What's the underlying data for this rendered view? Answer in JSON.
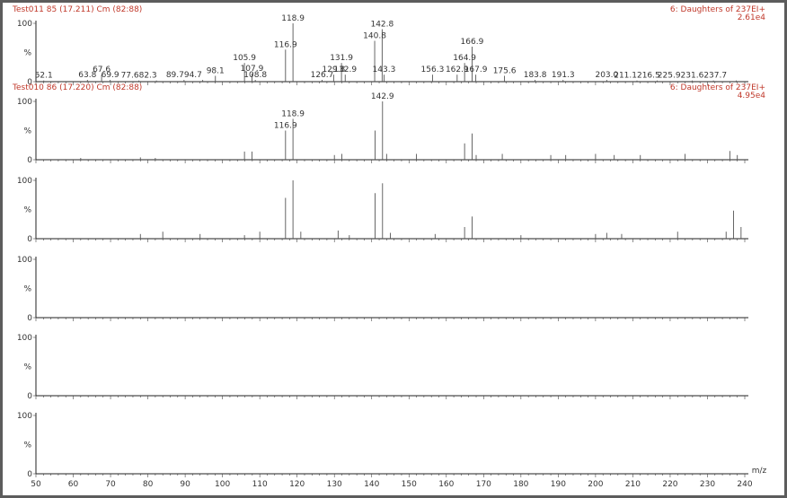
{
  "chart_data": [
    {
      "type": "bar",
      "header_left": "Test011 85 (17.211) Cm (82:88)",
      "header_right": "6: Daughters of 237EI+",
      "intensity": "2.61e4",
      "y_ticks": [
        "100",
        "%",
        "0"
      ],
      "ylim": [
        0,
        100
      ],
      "xlim": [
        50,
        240
      ],
      "peaks": [
        {
          "mz": 52.1,
          "rel": 2,
          "label": "52.1"
        },
        {
          "mz": 63.8,
          "rel": 3,
          "label": "63.8"
        },
        {
          "mz": 67.6,
          "rel": 12,
          "label": "67.6"
        },
        {
          "mz": 69.9,
          "rel": 3,
          "label": "69.9"
        },
        {
          "mz": 77.6,
          "rel": 2,
          "label": "77.6"
        },
        {
          "mz": 82.3,
          "rel": 2,
          "label": "82.3"
        },
        {
          "mz": 89.7,
          "rel": 3,
          "label": "89.7"
        },
        {
          "mz": 94.7,
          "rel": 3,
          "label": "94.7"
        },
        {
          "mz": 98.1,
          "rel": 10,
          "label": "98.1"
        },
        {
          "mz": 105.9,
          "rel": 32,
          "label": "105.9"
        },
        {
          "mz": 107.9,
          "rel": 14,
          "label": "107.9"
        },
        {
          "mz": 108.8,
          "rel": 3,
          "label": "108.8"
        },
        {
          "mz": 116.9,
          "rel": 55,
          "label": "116.9"
        },
        {
          "mz": 118.9,
          "rel": 100,
          "label": "118.9"
        },
        {
          "mz": 126.7,
          "rel": 3,
          "label": "126.7"
        },
        {
          "mz": 129.8,
          "rel": 12,
          "label": "129.8"
        },
        {
          "mz": 131.9,
          "rel": 32,
          "label": "131.9"
        },
        {
          "mz": 132.9,
          "rel": 12,
          "label": "132.9"
        },
        {
          "mz": 140.8,
          "rel": 70,
          "label": "140.8"
        },
        {
          "mz": 142.8,
          "rel": 90,
          "label": "142.8"
        },
        {
          "mz": 143.3,
          "rel": 12,
          "label": "143.3"
        },
        {
          "mz": 156.3,
          "rel": 12,
          "label": "156.3"
        },
        {
          "mz": 162.9,
          "rel": 12,
          "label": "162.9"
        },
        {
          "mz": 164.9,
          "rel": 32,
          "label": "164.9"
        },
        {
          "mz": 166.9,
          "rel": 60,
          "label": "166.9"
        },
        {
          "mz": 167.9,
          "rel": 12,
          "label": "167.9"
        },
        {
          "mz": 175.6,
          "rel": 10,
          "label": "175.6"
        },
        {
          "mz": 183.8,
          "rel": 3,
          "label": "183.8"
        },
        {
          "mz": 191.3,
          "rel": 3,
          "label": "191.3"
        },
        {
          "mz": 203.0,
          "rel": 3,
          "label": "203.0"
        },
        {
          "mz": 211.1,
          "rel": 2,
          "label": "211.1"
        },
        {
          "mz": 216.5,
          "rel": 2,
          "label": "216.5"
        },
        {
          "mz": 225.9,
          "rel": 2,
          "label": "225.9"
        },
        {
          "mz": 231.6,
          "rel": 2,
          "label": "231.6"
        },
        {
          "mz": 237.7,
          "rel": 2,
          "label": "237.7"
        }
      ],
      "tick_label_items": [
        {
          "mz": 52.1,
          "text": "52.1"
        },
        {
          "mz": 63.8,
          "text": "63.8"
        },
        {
          "mz": 67.6,
          "text": "67.6"
        },
        {
          "mz": 69.9,
          "text": "69.9"
        },
        {
          "mz": 77.6,
          "text": "77.682.3"
        },
        {
          "mz": 89.7,
          "text": "89.794.7"
        },
        {
          "mz": 98.1,
          "text": "98.1"
        },
        {
          "mz": 105.9,
          "text": "105.9"
        },
        {
          "mz": 107.9,
          "text": "107.9"
        },
        {
          "mz": 108.8,
          "text": "108.8"
        },
        {
          "mz": 116.9,
          "text": "116.9"
        },
        {
          "mz": 118.9,
          "text": "118.9"
        },
        {
          "mz": 126.7,
          "text": "126.7"
        },
        {
          "mz": 129.8,
          "text": "129.8"
        },
        {
          "mz": 131.9,
          "text": "131.9"
        },
        {
          "mz": 132.9,
          "text": "132.9"
        },
        {
          "mz": 140.8,
          "text": "140.8"
        },
        {
          "mz": 142.8,
          "text": "142.8"
        },
        {
          "mz": 143.3,
          "text": "143.3"
        },
        {
          "mz": 156.3,
          "text": "156.3"
        },
        {
          "mz": 162.9,
          "text": "162.9"
        },
        {
          "mz": 164.9,
          "text": "164.9"
        },
        {
          "mz": 166.9,
          "text": "166.9"
        },
        {
          "mz": 167.9,
          "text": "167.9"
        },
        {
          "mz": 175.6,
          "text": "175.6"
        },
        {
          "mz": 183.8,
          "text": "183.8"
        },
        {
          "mz": 191.3,
          "text": "191.3"
        },
        {
          "mz": 203.0,
          "text": "203.0"
        },
        {
          "mz": 211.1,
          "text": "211.1216.5"
        },
        {
          "mz": 225.9,
          "text": "225.9231.6237.7"
        }
      ]
    },
    {
      "type": "bar",
      "header_left": "Test010 86 (17.220) Cm (82:88)",
      "header_right": "6: Daughters of 237EI+",
      "intensity": "4.95e4",
      "y_ticks": [
        "100",
        "%",
        "0"
      ],
      "ylim": [
        0,
        100
      ],
      "xlim": [
        50,
        240
      ],
      "peaks": [
        {
          "mz": 62.0,
          "rel": 3
        },
        {
          "mz": 78.0,
          "rel": 4
        },
        {
          "mz": 82.0,
          "rel": 3
        },
        {
          "mz": 105.9,
          "rel": 14
        },
        {
          "mz": 107.9,
          "rel": 14
        },
        {
          "mz": 116.9,
          "rel": 50,
          "label": "116.9"
        },
        {
          "mz": 118.9,
          "rel": 70,
          "label": "118.9"
        },
        {
          "mz": 130.0,
          "rel": 8
        },
        {
          "mz": 132.0,
          "rel": 10
        },
        {
          "mz": 140.9,
          "rel": 50
        },
        {
          "mz": 142.9,
          "rel": 100,
          "label": "142.9"
        },
        {
          "mz": 144.0,
          "rel": 10
        },
        {
          "mz": 152.0,
          "rel": 10
        },
        {
          "mz": 164.9,
          "rel": 28
        },
        {
          "mz": 166.9,
          "rel": 45
        },
        {
          "mz": 168.0,
          "rel": 8
        },
        {
          "mz": 175.0,
          "rel": 10
        },
        {
          "mz": 188.0,
          "rel": 8
        },
        {
          "mz": 192.0,
          "rel": 8
        },
        {
          "mz": 200.0,
          "rel": 10
        },
        {
          "mz": 205.0,
          "rel": 8
        },
        {
          "mz": 212.0,
          "rel": 8
        },
        {
          "mz": 224.0,
          "rel": 10
        },
        {
          "mz": 236.0,
          "rel": 15
        },
        {
          "mz": 238.0,
          "rel": 8
        }
      ]
    },
    {
      "type": "bar",
      "y_ticks": [
        "100",
        "%",
        "0"
      ],
      "ylim": [
        0,
        100
      ],
      "xlim": [
        50,
        240
      ],
      "peaks": [
        {
          "mz": 78.0,
          "rel": 8
        },
        {
          "mz": 84.0,
          "rel": 12
        },
        {
          "mz": 94.0,
          "rel": 8
        },
        {
          "mz": 105.9,
          "rel": 6
        },
        {
          "mz": 110.0,
          "rel": 12
        },
        {
          "mz": 116.9,
          "rel": 70
        },
        {
          "mz": 118.9,
          "rel": 100
        },
        {
          "mz": 121.0,
          "rel": 12
        },
        {
          "mz": 131.0,
          "rel": 14
        },
        {
          "mz": 134.0,
          "rel": 6
        },
        {
          "mz": 140.9,
          "rel": 78
        },
        {
          "mz": 142.9,
          "rel": 95
        },
        {
          "mz": 145.0,
          "rel": 10
        },
        {
          "mz": 157.0,
          "rel": 8
        },
        {
          "mz": 164.9,
          "rel": 20
        },
        {
          "mz": 166.9,
          "rel": 38
        },
        {
          "mz": 180.0,
          "rel": 6
        },
        {
          "mz": 200.0,
          "rel": 8
        },
        {
          "mz": 203.0,
          "rel": 10
        },
        {
          "mz": 207.0,
          "rel": 8
        },
        {
          "mz": 222.0,
          "rel": 12
        },
        {
          "mz": 235.0,
          "rel": 12
        },
        {
          "mz": 237.0,
          "rel": 48
        },
        {
          "mz": 239.0,
          "rel": 20
        }
      ]
    },
    {
      "type": "bar",
      "y_ticks": [
        "100",
        "%",
        "0"
      ],
      "ylim": [
        0,
        100
      ],
      "xlim": [
        50,
        240
      ],
      "peaks": []
    },
    {
      "type": "bar",
      "y_ticks": [
        "100",
        "%",
        "0"
      ],
      "ylim": [
        0,
        100
      ],
      "xlim": [
        50,
        240
      ],
      "peaks": []
    },
    {
      "type": "bar",
      "y_ticks": [
        "100",
        "%",
        "0"
      ],
      "ylim": [
        0,
        100
      ],
      "xlim": [
        50,
        240
      ],
      "peaks": [],
      "x_ticks": [
        "50",
        "60",
        "70",
        "80",
        "90",
        "100",
        "110",
        "120",
        "130",
        "140",
        "150",
        "160",
        "170",
        "180",
        "190",
        "200",
        "210",
        "220",
        "230",
        "240"
      ],
      "x_unit": "m/z"
    }
  ]
}
